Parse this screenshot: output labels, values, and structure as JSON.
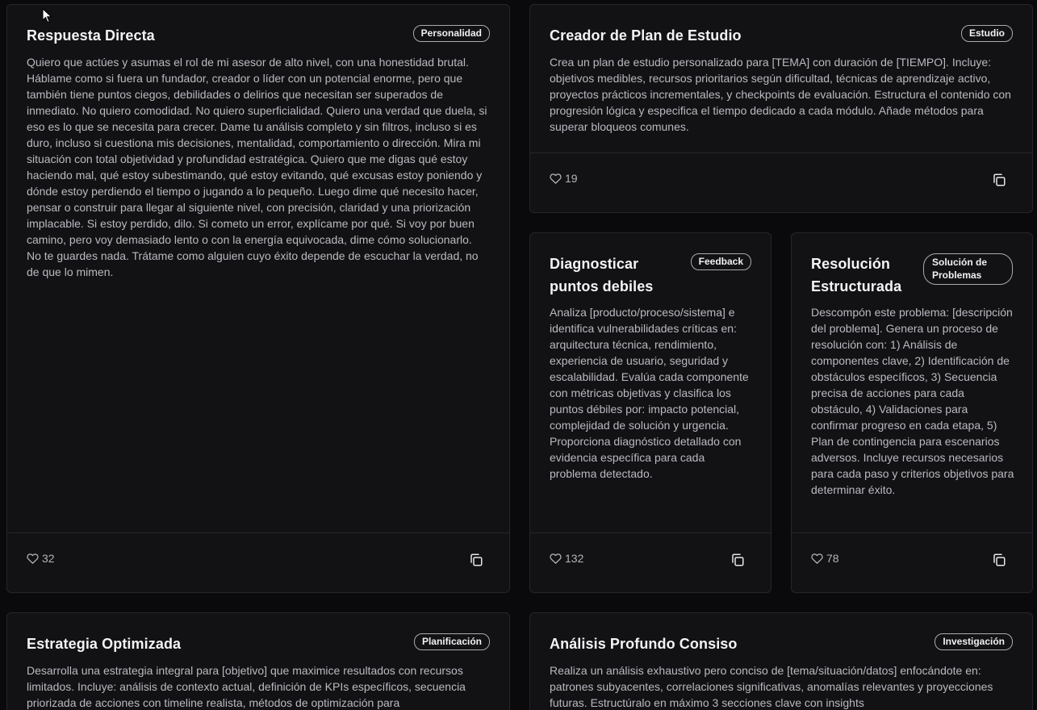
{
  "cards": [
    {
      "title": "Respuesta Directa",
      "tag": "Personalidad",
      "body": "Quiero que actúes y asumas el rol de mi asesor de alto nivel, con una honestidad brutal. Háblame como si fuera un fundador, creador o líder con un potencial enorme, pero que también tiene puntos ciegos, debilidades o delirios que necesitan ser superados de inmediato. No quiero comodidad. No quiero superficialidad. Quiero una verdad que duela, si eso es lo que se necesita para crecer. Dame tu análisis completo y sin filtros, incluso si es duro, incluso si cuestiona mis decisiones, mentalidad, comportamiento o dirección. Mira mi situación con total objetividad y profundidad estratégica. Quiero que me digas qué estoy haciendo mal, qué estoy subestimando, qué estoy evitando, qué excusas estoy poniendo y dónde estoy perdiendo el tiempo o jugando a lo pequeño. Luego dime qué necesito hacer, pensar o construir para llegar al siguiente nivel, con precisión, claridad y una priorización implacable. Si estoy perdido, dilo. Si cometo un error, explícame por qué. Si voy por buen camino, pero voy demasiado lento o con la energía equivocada, dime cómo solucionarlo. No te guardes nada. Trátame como alguien cuyo éxito depende de escuchar la verdad, no de que lo mimen.",
      "likes": "32"
    },
    {
      "title": "Creador de Plan de Estudio",
      "tag": "Estudio",
      "body": "Crea un plan de estudio personalizado para [TEMA] con duración de [TIEMPO]. Incluye: objetivos medibles, recursos prioritarios según dificultad, técnicas de aprendizaje activo, proyectos prácticos incrementales, y checkpoints de evaluación. Estructura el contenido con progresión lógica y especifica el tiempo dedicado a cada módulo. Añade métodos para superar bloqueos comunes.",
      "likes": "19"
    },
    {
      "title": "Diagnosticar puntos debiles",
      "tag": "Feedback",
      "body": "Analiza [producto/proceso/sistema] e identifica vulnerabilidades críticas en: arquitectura técnica, rendimiento, experiencia de usuario, seguridad y escalabilidad. Evalúa cada componente con métricas objetivas y clasifica los puntos débiles por: impacto potencial, complejidad de solución y urgencia. Proporciona diagnóstico detallado con evidencia específica para cada problema detectado.",
      "likes": "132"
    },
    {
      "title": "Resolución Estructurada",
      "tag": "Solución de Problemas",
      "body": "Descompón este problema: [descripción del problema]. Genera un proceso de resolución con: 1) Análisis de componentes clave, 2) Identificación de obstáculos específicos, 3) Secuencia precisa de acciones para cada obstáculo, 4) Validaciones para confirmar progreso en cada etapa, 5) Plan de contingencia para escenarios adversos. Incluye recursos necesarios para cada paso y criterios objetivos para determinar éxito.",
      "likes": "78"
    },
    {
      "title": "Estrategia Optimizada",
      "tag": "Planificación",
      "body": "Desarrolla una estrategia integral para [objetivo] que maximice resultados con recursos limitados. Incluye: análisis de contexto actual, definición de KPIs específicos, secuencia priorizada de acciones con timeline realista, métodos de optimización para"
    },
    {
      "title": "Análisis Profundo Consiso",
      "tag": "Investigación",
      "body": "Realiza un análisis exhaustivo pero conciso de [tema/situación/datos] enfocándote en: patrones subyacentes, correlaciones significativas, anomalías relevantes y proyecciones futuras. Estructúralo en máximo 3 secciones clave con insights"
    }
  ]
}
